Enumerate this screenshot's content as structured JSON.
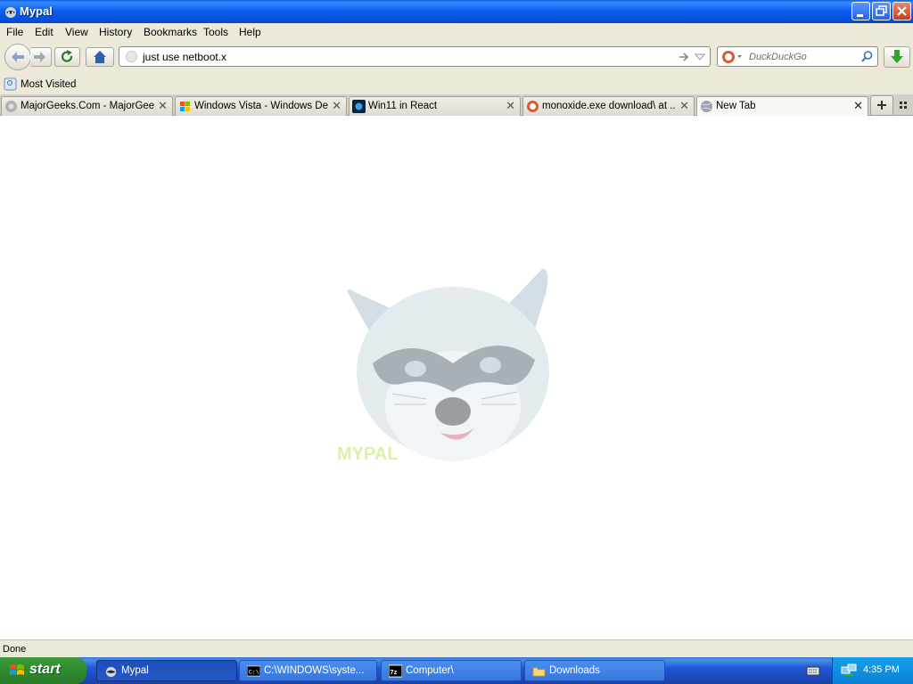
{
  "window": {
    "title": "Mypal"
  },
  "menu": [
    "File",
    "Edit",
    "View",
    "History",
    "Bookmarks",
    "Tools",
    "Help"
  ],
  "url": {
    "value": "just use netboot.x"
  },
  "search": {
    "placeholder": "DuckDuckGo"
  },
  "bookmarks": {
    "most_visited": "Most Visited"
  },
  "tabs": [
    {
      "label": "MajorGeeks.Com - MajorGeeks"
    },
    {
      "label": "Windows Vista - Windows De..."
    },
    {
      "label": "Win11 in React"
    },
    {
      "label": "monoxide.exe download\\ at ..."
    },
    {
      "label": "New Tab"
    }
  ],
  "content": {
    "logo_text": "MYPAL"
  },
  "status": {
    "text": "Done"
  },
  "taskbar": {
    "start": "start",
    "buttons": [
      {
        "label": "Mypal"
      },
      {
        "label": "C:\\WINDOWS\\syste..."
      },
      {
        "label": "Computer\\"
      },
      {
        "label": "Downloads"
      }
    ],
    "clock": "4:35 PM"
  }
}
